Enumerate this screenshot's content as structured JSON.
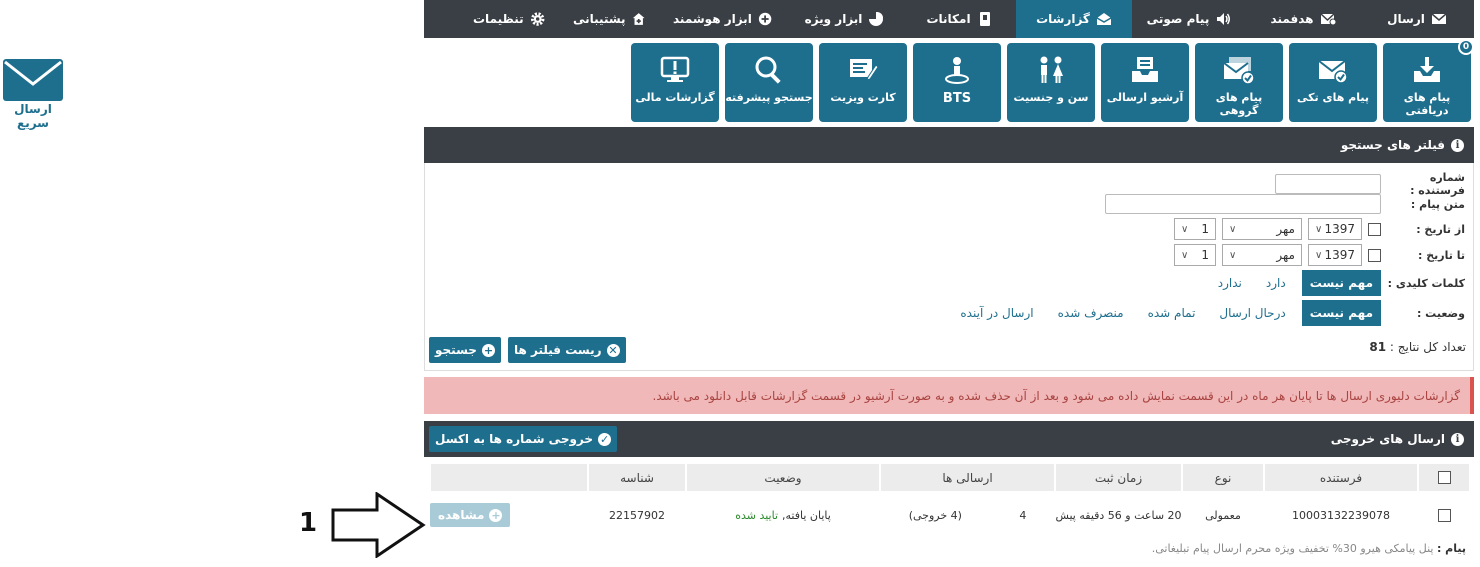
{
  "quick_send": {
    "label": "ارسال سریع"
  },
  "nav": [
    {
      "label": "ارسال",
      "icon": "envelope-icon",
      "active": false
    },
    {
      "label": "هدفمند",
      "icon": "envelope-target-icon",
      "active": false
    },
    {
      "label": "پیام صوتی",
      "icon": "speaker-icon",
      "active": false
    },
    {
      "label": "گزارشات",
      "icon": "envelope-open-icon",
      "active": true
    },
    {
      "label": "امکانات",
      "icon": "book-icon",
      "active": false
    },
    {
      "label": "ابزار ویژه",
      "icon": "pie-chart-icon",
      "active": false
    },
    {
      "label": "ابزار هوشمند",
      "icon": "plus-circle-icon",
      "active": false
    },
    {
      "label": "پشتیبانی",
      "icon": "home-plus-icon",
      "active": false
    },
    {
      "label": "تنظیمات",
      "icon": "gear-icon",
      "active": false
    }
  ],
  "tiles": [
    {
      "label": "پیام های دریافتی",
      "icon": "inbox-download-icon",
      "badge": "0"
    },
    {
      "label": "پیام های تکی",
      "icon": "envelope-check-icon"
    },
    {
      "label": "پیام های گروهی",
      "icon": "envelopes-group-icon"
    },
    {
      "label": "آرشیو ارسالی",
      "icon": "archive-icon"
    },
    {
      "label": "سن و جنسیت",
      "icon": "gender-icon"
    },
    {
      "label": "BTS",
      "icon": "map-pin-icon"
    },
    {
      "label": "کارت ویزیت",
      "icon": "business-card-icon"
    },
    {
      "label": "جستجو پیشرفته",
      "icon": "magnifier-icon"
    },
    {
      "label": "گزارشات مالی",
      "icon": "monitor-alert-icon"
    }
  ],
  "filters": {
    "title": "فیلتر های جستجو",
    "sender_label": "شماره فرستنده :",
    "text_label": "متن پیام :",
    "from_label": "از تاریخ :",
    "to_label": "تا تاریخ :",
    "from_year": "1397",
    "from_month": "مهر",
    "from_day": "1",
    "to_year": "1397",
    "to_month": "مهر",
    "to_day": "1",
    "keywords_label": "کلمات کلیدی :",
    "keywords_options": [
      "مهم نیست",
      "دارد",
      "ندارد"
    ],
    "status_label": "وضعیت :",
    "status_options": [
      "مهم نیست",
      "درحال ارسال",
      "تمام شده",
      "منصرف شده",
      "ارسال در آینده"
    ],
    "count_label": "تعداد کل نتایج :",
    "count_value": "81",
    "reset_label": "ریست فیلتر ها",
    "search_label": "جستجو"
  },
  "alert": "گزارشات دلیوری ارسال ها تا پایان هر ماه در این قسمت نمایش داده می شود و بعد از آن حذف شده و به صورت آرشیو در قسمت گزارشات قابل دانلود می باشد.",
  "outbox": {
    "title": "ارسال های خروجی",
    "export_label": "خروجی شماره ها به اکسل",
    "columns": [
      "فرستنده",
      "نوع",
      "زمان ثبت",
      "ارسالی ها",
      "وضعیت",
      "شناسه"
    ],
    "row": {
      "sender": "10003132239078",
      "type": "معمولی",
      "time": "20 ساعت و 56 دقیقه پیش",
      "sent_count": "4",
      "sent_detail": "(4 خروجی)",
      "status_prefix": "پایان یافته,",
      "status_ok": "تایید شده",
      "id": "22157902",
      "view_label": "مشاهده"
    },
    "message_label": "پیام :",
    "message_text": "پنل پیامکی هیرو 30% تخفیف ویژه محرم ارسال پیام تبلیغاتی."
  },
  "annotation": {
    "number": "1"
  },
  "colors": {
    "primary": "#1e6f8e",
    "dark": "#3a3f45",
    "alert_bg": "#f0b8b8",
    "success": "#2e8b2e"
  }
}
